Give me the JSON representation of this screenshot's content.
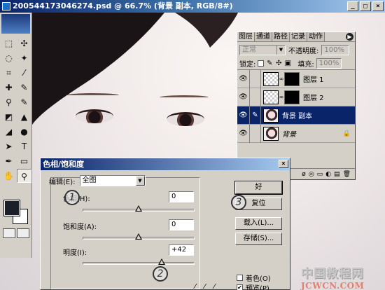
{
  "window": {
    "title": "200544173046274.psd @ 66.7% (背景 副本, RGB/8#)",
    "min_glyph": "_",
    "max_glyph": "□",
    "close_glyph": "×"
  },
  "toolbox": {
    "tools": [
      "⬚",
      "✣",
      "◌",
      "✦",
      "⌗",
      "⁄",
      "✚",
      "✎",
      "⚲",
      "✎",
      "◩",
      "▲",
      "◢",
      "●",
      "➤",
      "T",
      "✒",
      "▭",
      "✋",
      "⚲"
    ],
    "foreground_color": "#1b2028",
    "background_color": "#ffffff"
  },
  "layers_panel": {
    "tabs": [
      "图层",
      "通道",
      "路径",
      "记录",
      "动作"
    ],
    "menu_glyph": "▶",
    "blend_mode": "正常",
    "opacity_label": "不透明度:",
    "opacity_value": "100%",
    "lock_label": "锁定:",
    "fill_label": "填充:",
    "fill_value": "100%",
    "layers": [
      {
        "name": "图层 1",
        "selected": false
      },
      {
        "name": "图层 2",
        "selected": false
      },
      {
        "name": "背景 副本",
        "selected": true
      },
      {
        "name": "背景",
        "selected": false
      }
    ],
    "footer_icons": [
      "ø",
      "◎",
      "▭",
      "◐",
      "▤",
      "🗑"
    ]
  },
  "dialog": {
    "title": "色相/饱和度",
    "close_glyph": "×",
    "edit_label": "编辑(E):",
    "edit_value": "全图",
    "hue_label": "色相(H):",
    "hue_value": "0",
    "saturation_label": "饱和度(A):",
    "saturation_value": "0",
    "lightness_label": "明度(I):",
    "lightness_value": "+42",
    "ok_button": "好",
    "reset_button": "复位",
    "load_button": "载入(L)...",
    "save_button": "存储(S)...",
    "colorize_label": "着色(O)",
    "preview_label": "预览(P)",
    "preview_checked": true,
    "colorize_checked": false
  },
  "callouts": [
    "1",
    "2",
    "3"
  ],
  "watermark": {
    "line1": "中国教程网",
    "line2": "JCWCN.COM"
  }
}
